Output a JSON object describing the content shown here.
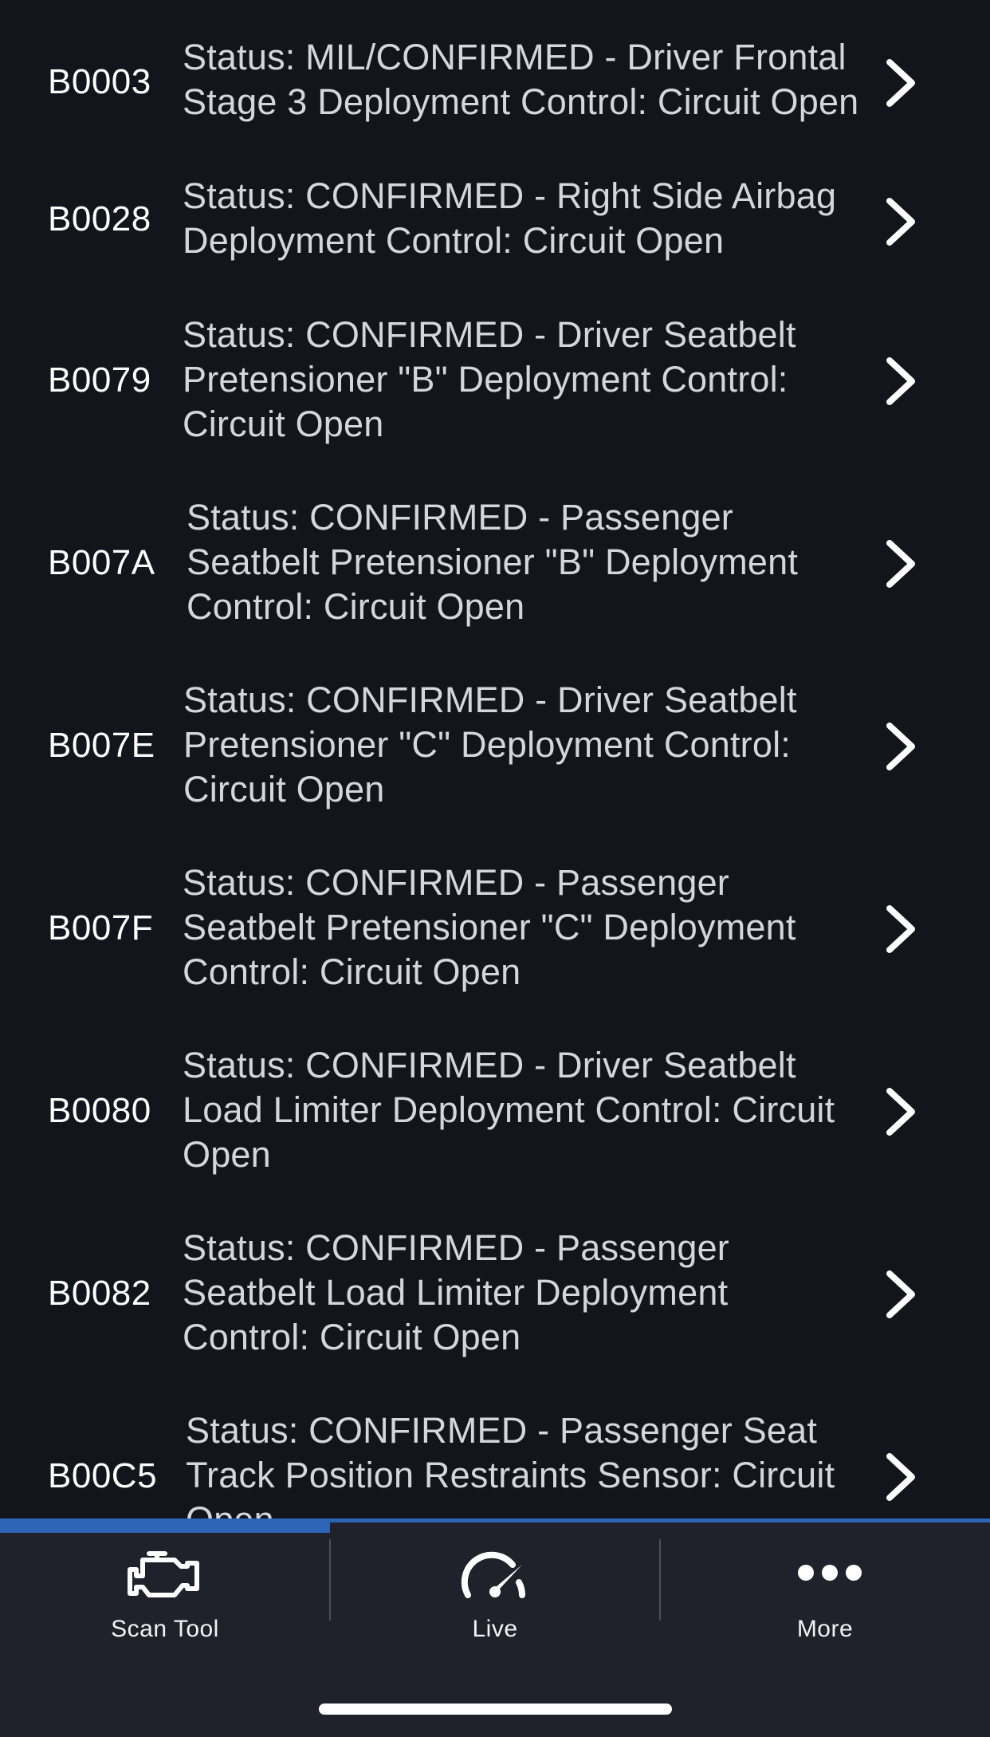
{
  "dtc_list": [
    {
      "code": "B0003",
      "lines": [
        "Status: MIL/CONFIRMED - Driver Frontal",
        "Stage 3 Deployment Control: Circuit Open"
      ]
    },
    {
      "code": "B0028",
      "lines": [
        "Status: CONFIRMED - Right Side Airbag",
        "Deployment Control: Circuit Open"
      ]
    },
    {
      "code": "B0079",
      "lines": [
        "Status: CONFIRMED - Driver Seatbelt",
        "Pretensioner \"B\" Deployment Control:",
        "Circuit Open"
      ]
    },
    {
      "code": "B007A",
      "lines": [
        "Status: CONFIRMED - Passenger",
        "Seatbelt Pretensioner \"B\" Deployment",
        "Control: Circuit Open"
      ]
    },
    {
      "code": "B007E",
      "lines": [
        "Status: CONFIRMED - Driver Seatbelt",
        "Pretensioner \"C\" Deployment Control:",
        "Circuit Open"
      ]
    },
    {
      "code": "B007F",
      "lines": [
        "Status: CONFIRMED - Passenger",
        "Seatbelt Pretensioner \"C\" Deployment",
        "Control: Circuit Open"
      ]
    },
    {
      "code": "B0080",
      "lines": [
        "Status: CONFIRMED - Driver Seatbelt",
        "Load Limiter Deployment Control: Circuit",
        "Open"
      ]
    },
    {
      "code": "B0082",
      "lines": [
        "Status: CONFIRMED - Passenger",
        "Seatbelt Load Limiter Deployment",
        "Control: Circuit Open"
      ]
    },
    {
      "code": "B00C5",
      "lines": [
        "Status: CONFIRMED - Passenger Seat",
        "Track Position Restraints Sensor: Circuit",
        "Open"
      ]
    }
  ],
  "row_icon": "chevron-right-icon",
  "tab_bar": {
    "tabs": [
      {
        "label": "Scan Tool",
        "icon": "engine-icon",
        "selected": true
      },
      {
        "label": "Live",
        "icon": "speedometer-icon",
        "selected": false
      },
      {
        "label": "More",
        "icon": "more-dots-icon",
        "selected": false
      }
    ]
  },
  "colors": {
    "background": "#13151c",
    "tab_bar_background": "#1f222b",
    "accent": "#2d64b7",
    "code_text": "#ffffff",
    "description_text": "#d4d6dc"
  }
}
